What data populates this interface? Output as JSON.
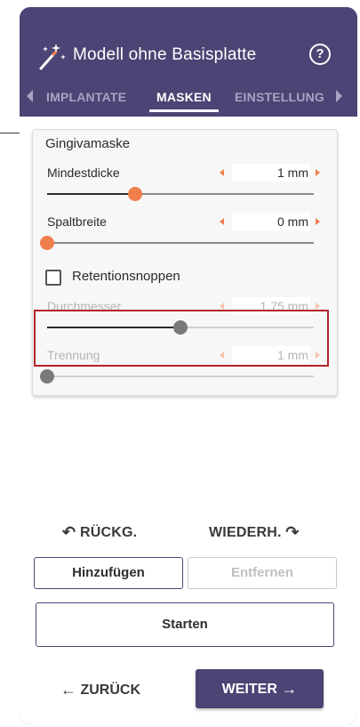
{
  "header": {
    "title": "Modell ohne Basisplatte",
    "help_icon": "?"
  },
  "tabs": [
    {
      "label": "IMPLANTATE",
      "active": false
    },
    {
      "label": "MASKEN",
      "active": true
    },
    {
      "label": "EINSTELLUNG",
      "active": false
    }
  ],
  "gingiva": {
    "title": "Gingivamaske",
    "mindestdicke": {
      "label": "Mindestdicke",
      "value": "1 mm",
      "level": 0.33,
      "enabled": true
    },
    "spaltbreite": {
      "label": "Spaltbreite",
      "value": "0 mm",
      "level": 0.0,
      "enabled": true
    },
    "retention": {
      "label": "Retentionsnoppen",
      "checked": false
    },
    "durchmesser": {
      "label": "Durchmesser",
      "value": "1,75 mm",
      "level": 0.5,
      "enabled": false
    },
    "trennung": {
      "label": "Trennung",
      "value": "1 mm",
      "level": 0.0,
      "enabled": false
    }
  },
  "actions": {
    "undo_label": "RÜCKG.",
    "redo_label": "WIEDERH.",
    "add_label": "Hinzufügen",
    "remove_label": "Entfernen",
    "start_label": "Starten"
  },
  "nav": {
    "back_label": "ZURÜCK",
    "next_label": "WEITER"
  },
  "colors": {
    "panel": "#4b4474",
    "accent": "#f07e4d",
    "highlight": "#b3242a"
  },
  "icons": [
    "magic-wand-icon",
    "help-icon",
    "chevron-left-icon",
    "chevron-right-icon",
    "undo-icon",
    "redo-icon",
    "arrow-left-icon",
    "arrow-right-icon"
  ]
}
